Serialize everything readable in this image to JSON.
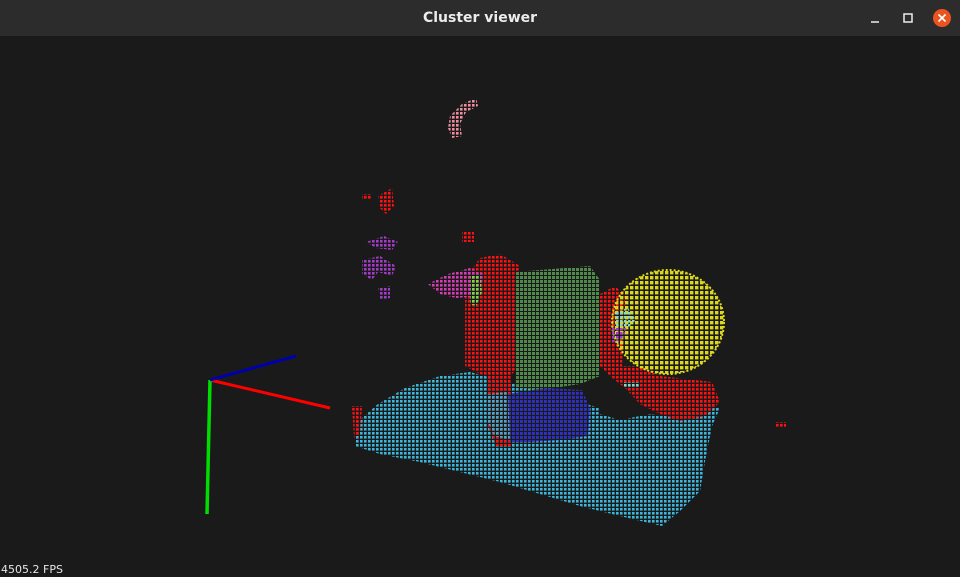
{
  "window": {
    "title": "Cluster viewer",
    "buttons": {
      "minimize": "minimize",
      "maximize": "maximize",
      "close": "close"
    }
  },
  "colors": {
    "titlebar": "#2c2c2c",
    "background": "#1a1a1a",
    "close_button": "#e95420",
    "axis_x": "#ff0000",
    "axis_y": "#00dd00",
    "axis_z": "#0000aa",
    "floor": "#3bb7dc",
    "red_cluster": "#ff1010",
    "green_box": "#4f8a4a",
    "blue_box": "#2f2fc8",
    "yellow_sphere": "#dcd81a",
    "magenta": "#d83cb4",
    "purple": "#a23cc8",
    "pink": "#f08ca0",
    "light_green": "#7cd84a",
    "teal": "#8ad6c6"
  },
  "viewer": {
    "fps_label": "4505.2 FPS"
  }
}
